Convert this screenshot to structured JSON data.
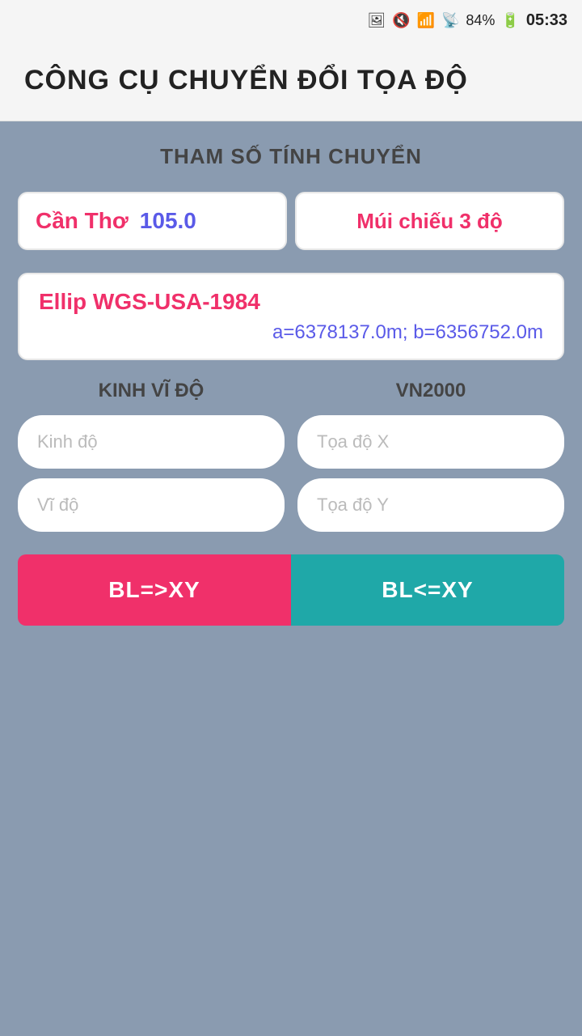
{
  "statusBar": {
    "time": "05:33",
    "battery": "84%",
    "icons": [
      "mute-icon",
      "wifi-icon",
      "signal-icon",
      "battery-icon"
    ]
  },
  "appBar": {
    "title": "CÔNG CỤ CHUYỂN ĐỔI TỌA ĐỘ"
  },
  "params": {
    "sectionLabel": "THAM SỐ TÍNH CHUYỂN",
    "canThoLabel": "Cần Thơ",
    "canThoValue": "105.0",
    "muiChieuLabel": "Múi chiếu 3 độ",
    "ellipTitle": "Ellip WGS-USA-1984",
    "ellipParams": "a=6378137.0m; b=6356752.0m"
  },
  "inputs": {
    "leftColumnLabel": "KINH VĨ ĐỘ",
    "rightColumnLabel": "VN2000",
    "kinhDoPlaceholder": "Kinh độ",
    "viDoPlaceholder": "Vĩ độ",
    "toaDoXPlaceholder": "Tọa độ X",
    "toaDoYPlaceholder": "Tọa độ Y"
  },
  "buttons": {
    "blToXy": "BL=>XY",
    "xyToBl": "BL<=XY"
  }
}
